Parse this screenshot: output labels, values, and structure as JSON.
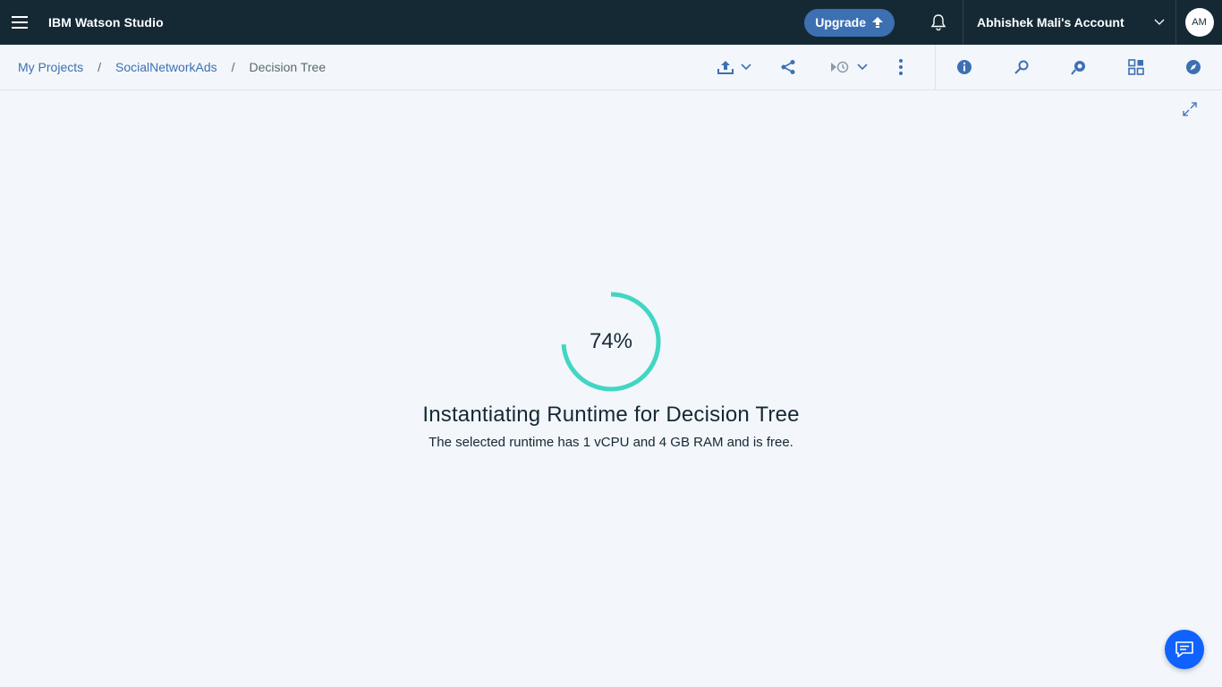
{
  "header": {
    "app_title": "IBM Watson Studio",
    "upgrade_label": "Upgrade",
    "account_name": "Abhishek Mali's Account",
    "avatar_initials": "AM"
  },
  "breadcrumb": {
    "items": [
      "My Projects",
      "SocialNetworkAds"
    ],
    "separator": "/",
    "current": "Decision Tree"
  },
  "toolbar": {
    "icons": [
      "upload-icon",
      "share-icon",
      "schedule-icon",
      "overflow-menu-icon",
      "info-icon",
      "find-replace-icon",
      "version-icon",
      "data-assets-icon",
      "discover-icon"
    ]
  },
  "loader": {
    "progress_label": "74%",
    "progress_value": 0.74,
    "title": "Instantiating Runtime for Decision Tree",
    "subtitle": "The selected runtime has 1 vCPU and 4 GB RAM and is free."
  },
  "colors": {
    "header_bg": "#152935",
    "accent": "#3d70b2",
    "progress": "#41d6c3",
    "chat_button": "#0f62fe"
  }
}
